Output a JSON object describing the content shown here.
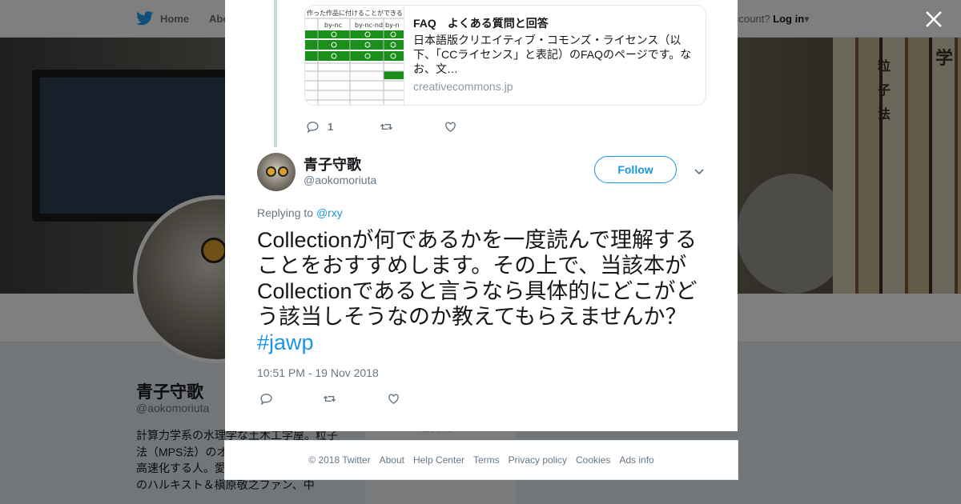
{
  "nav": {
    "home": "Home",
    "about": "Abo",
    "account_prompt": "ccount?",
    "login": "Log in"
  },
  "banner": {
    "book_chars": [
      "粒",
      "子",
      "法",
      "学"
    ]
  },
  "profile": {
    "name": "青子守歌",
    "handle": "@aokomoriuta",
    "bio": "計算力学系の水理学な土木工学屋。粒子法（MPS法）のオ OpenMPS開発者 かで高速化する人。愛知県一宮市出身。重度のハルキスト＆槇原敬之ファン、中"
  },
  "ads_fragment": "Ads info",
  "modal": {
    "link_card": {
      "title": "FAQ　よくある質問と回答",
      "description": "日本語版クリエイティブ・コモンズ・ライセンス（以下、「CCライセンス」と表記）のFAQのページです。なお、文…",
      "domain": "creativecommons.jp",
      "thumb_header": "作った作品に付けることができる",
      "thumb_columns": [
        "by-nc",
        "by-nc-nd",
        "by-n"
      ]
    },
    "prev_actions": {
      "reply_count": "1"
    },
    "tweet": {
      "display_name": "青子守歌",
      "handle": "@aokomoriuta",
      "follow_label": "Follow",
      "replying_to_prefix": "Replying to",
      "replying_to_user": "@rxy",
      "text": "Collectionが何であるかを一度読んで理解することをおすすめします。その上で、当該本がCollectionであると言うなら具体的にどこがどう該当しそうなのか教えてもらえませんか？",
      "hashtag": "#jawp",
      "timestamp": "10:51 PM - 19 Nov 2018"
    }
  },
  "footer": {
    "copyright": "© 2018 Twitter",
    "links": [
      "About",
      "Help Center",
      "Terms",
      "Privacy policy",
      "Cookies",
      "Ads info"
    ]
  },
  "colors": {
    "brand_blue": "#1da1f2",
    "link_blue": "#1b95e0",
    "muted": "#657786",
    "thumb_green": "#1a8f1a"
  },
  "icons": [
    "twitter-bird-icon",
    "reply-icon",
    "retweet-icon",
    "like-icon",
    "chevron-down-icon",
    "close-icon"
  ]
}
